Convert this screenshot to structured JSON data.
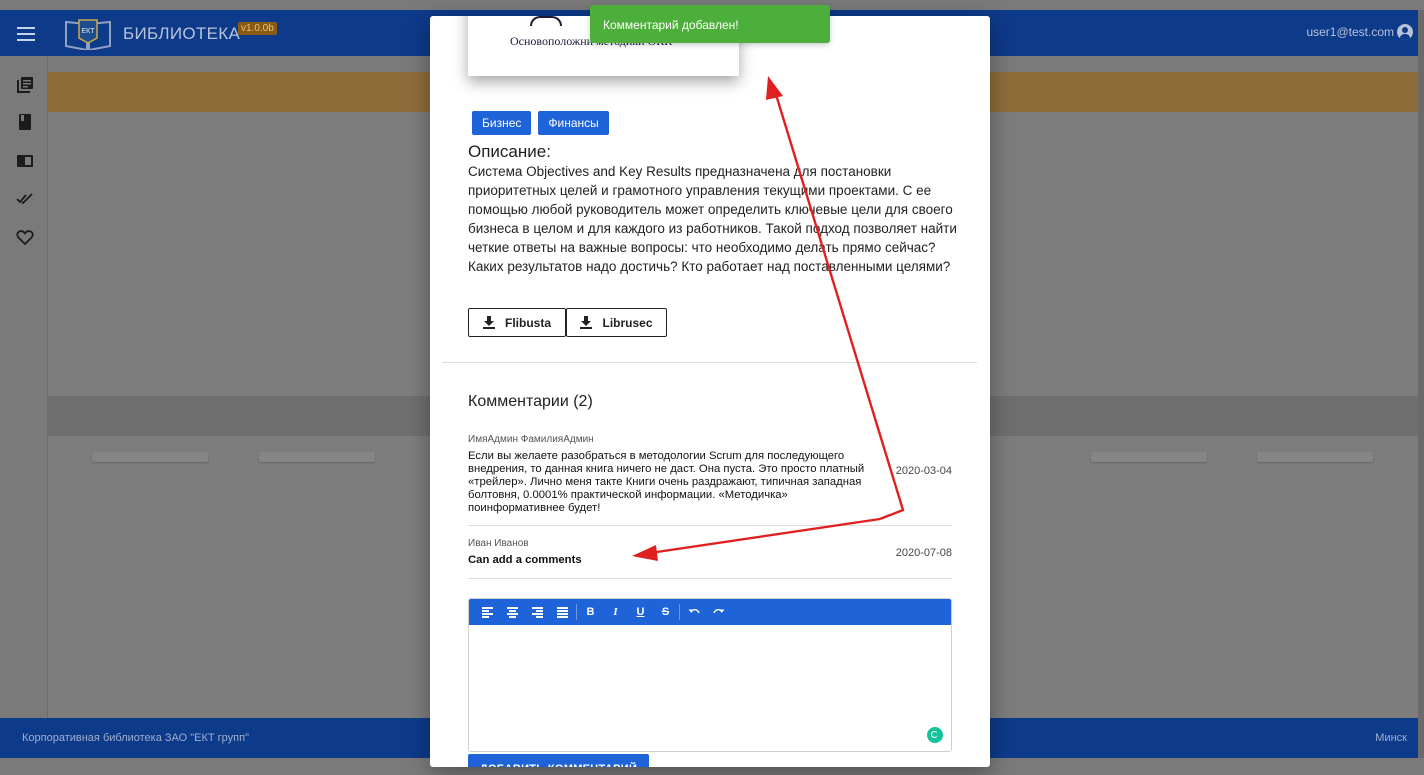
{
  "header": {
    "app_title": "БИБЛИОТЕКА",
    "version": "v1.0.0b",
    "logo_text": "ЕКТ",
    "user_email": "user1@test.com"
  },
  "sidebar": {
    "items": [
      {
        "icon": "library-books-icon"
      },
      {
        "icon": "book-icon"
      },
      {
        "icon": "chrome-reader-icon"
      },
      {
        "icon": "done-all-icon"
      },
      {
        "icon": "heart-icon"
      }
    ]
  },
  "footer": {
    "left": "Корпоративная библиотека ЗАО \"ЕКТ групп\"",
    "right": "Минск"
  },
  "toast": {
    "message": "Комментарий добавлен!",
    "color": "#4caf3b"
  },
  "book": {
    "cover_text": "Основоположни методики ОКR",
    "tags": [
      "Бизнес",
      "Финансы"
    ],
    "description_title": "Описание:",
    "description": "Система Objectives and Key Results предназначена для постановки приоритетных целей и грамотного управления текущими проектами. С ее помощью любой руководитель может определить ключевые цели для своего бизнеса в целом и для каждого из работников. Такой подход позволяет найти четкие ответы на важные вопросы: что необходимо делать прямо сейчас? Каких результатов надо достичь? Кто работает над поставленными целями?",
    "downloads": [
      {
        "label": "Flibusta"
      },
      {
        "label": "Librusec"
      }
    ]
  },
  "comments": {
    "title": "Комментарии (2)",
    "items": [
      {
        "author": "ИмяАдмин ФамилияАдмин",
        "text": "Если вы желаете разобраться в методологии Scrum для последующего внедрения, то данная книга ничего не даст. Она пуста. Это просто платный «трейлер». Лично меня такте Книги очень раздражают, типичная западная болтовня, 0.0001% практической информации. «Методичка» поинформативнее будет!",
        "date": "2020-03-04"
      },
      {
        "author": "Иван Иванов",
        "text": "Can add a comments",
        "date": "2020-07-08"
      }
    ]
  },
  "editor": {
    "toolbar": [
      "align-left-icon",
      "align-center-icon",
      "align-right-icon",
      "align-justify-icon",
      "bold-icon",
      "italic-icon",
      "underline-icon",
      "strikethrough-icon",
      "undo-icon",
      "redo-icon"
    ],
    "bold_glyph": "B",
    "italic_glyph": "I",
    "underline_glyph": "U",
    "strike_glyph": "S",
    "value": ""
  },
  "add_comment_button": "ДОБАВИТЬ КОММЕНТАРИЙ",
  "colors": {
    "header": "#0e3a8a",
    "accent": "#1e63d8",
    "annotation_arrow": "#e02020"
  }
}
